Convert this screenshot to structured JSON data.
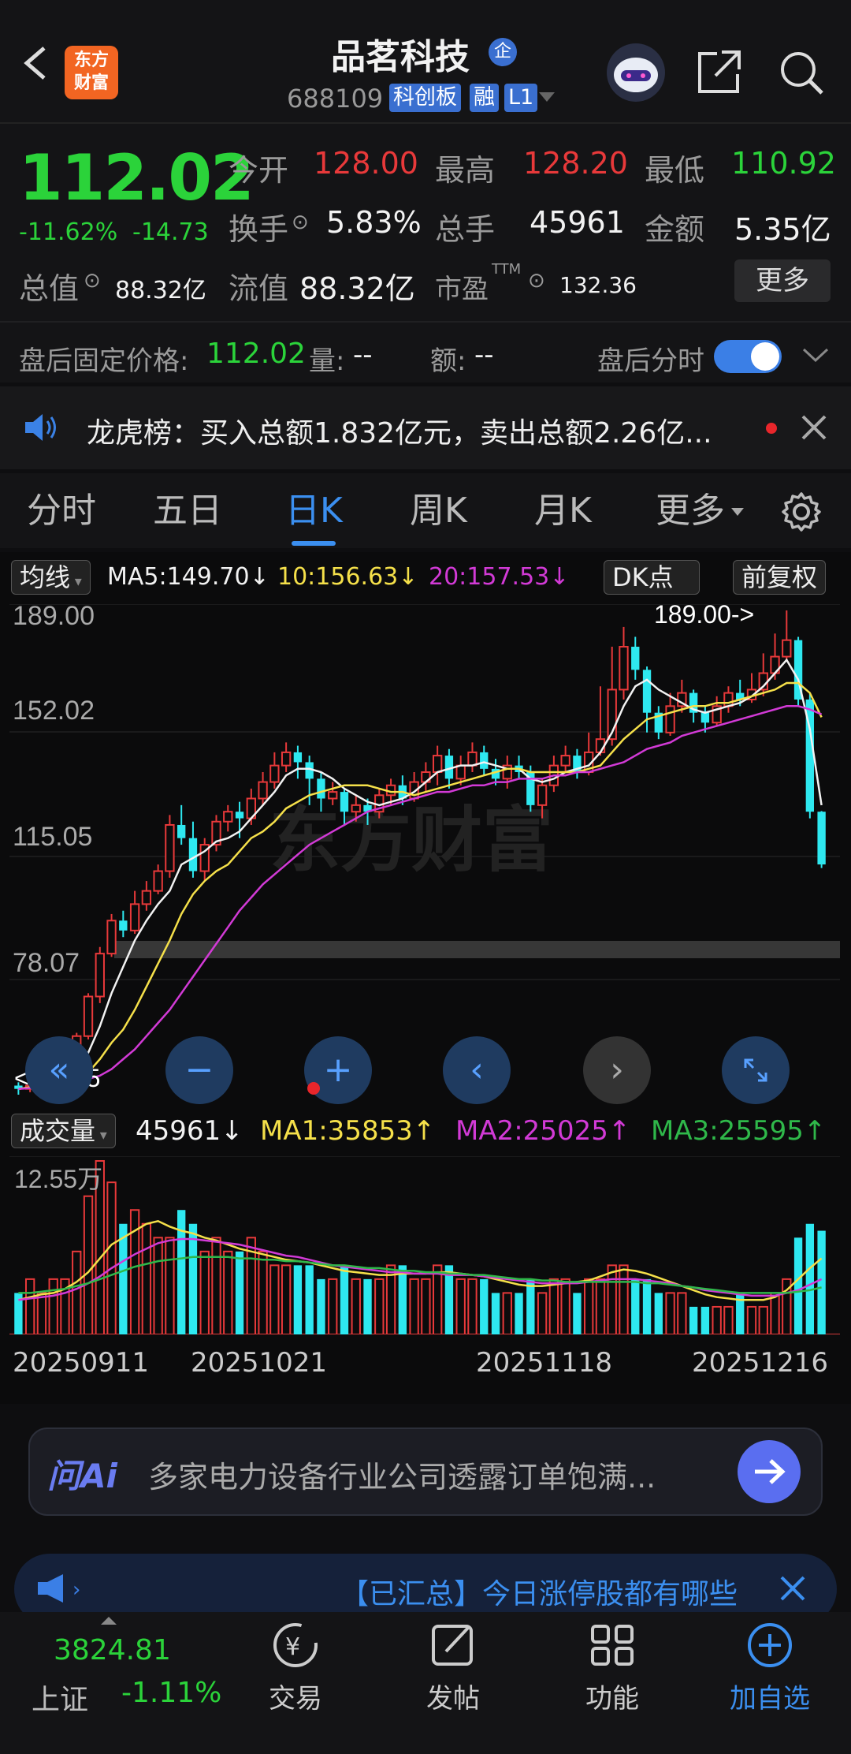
{
  "header": {
    "logo_line1": "东方",
    "logo_line2": "财富",
    "stock_name": "品茗科技",
    "badge_qi": "企",
    "stock_code": "688109",
    "tag_board": "科创板",
    "tag_margin": "融",
    "tag_level": "L1"
  },
  "quote": {
    "price": "112.02",
    "change_pct": "-11.62%",
    "change_amt": "-14.73",
    "open_label": "今开",
    "open": "128.00",
    "high_label": "最高",
    "high": "128.20",
    "low_label": "最低",
    "low": "110.92",
    "turnover_label": "换手",
    "turnover": "5.83%",
    "volume_label": "总手",
    "volume": "45961",
    "amount_label": "金额",
    "amount": "5.35亿",
    "mktcap_label": "总值",
    "mktcap": "88.32亿",
    "float_label": "流值",
    "float_cap": "88.32亿",
    "pe_label": "市盈",
    "pe_sup": "TTM",
    "pe": "132.36",
    "more_label": "更多"
  },
  "after_hours": {
    "label": "盘后固定价格:",
    "price": "112.02",
    "vol_label": "量:",
    "vol": "--",
    "amt_label": "额:",
    "amt": "--",
    "timeshare_label": "盘后分时"
  },
  "notice": {
    "text": "龙虎榜：买入总额1.832亿元，卖出总额2.26亿..."
  },
  "tabs": [
    "分时",
    "五日",
    "日K",
    "周K",
    "月K",
    "更多"
  ],
  "kline": {
    "ma_label": "均线",
    "ma5": "MA5:149.70↓",
    "ma10": "10:156.63↓",
    "ma20": "20:157.53↓",
    "dk_label": "DK点",
    "adjust_label": "前复权",
    "y_labels": [
      "189.00",
      "152.02",
      "115.05",
      "78.07"
    ],
    "high_marker": "189.00->",
    "low_marker": "<-42.25",
    "watermark": "东方财富"
  },
  "volume": {
    "label": "成交量",
    "value": "45961↓",
    "ma1": "MA1:35853↑",
    "ma2": "MA2:25025↑",
    "ma3": "MA3:25595↑",
    "y_label": "12.55万",
    "dates": [
      "20250911",
      "20251021",
      "20251118",
      "20251216"
    ]
  },
  "ai": {
    "logo": "问Ai",
    "text": "多家电力设备行业公司透露订单饱满..."
  },
  "banner": {
    "text": "【已汇总】今日涨停股都有哪些"
  },
  "bottom_nav": {
    "index_value": "3824.81",
    "index_name": "上证",
    "index_change": "-1.11%",
    "items": [
      "交易",
      "发帖",
      "功能",
      "加自选"
    ]
  },
  "chart_data": {
    "type": "candlestick",
    "ylim": [
      42.25,
      189.0
    ],
    "candles": [
      [
        45,
        44,
        46,
        42.25
      ],
      [
        44,
        45,
        46,
        43
      ],
      [
        45,
        46,
        47,
        44
      ],
      [
        46,
        47,
        48,
        45
      ],
      [
        47,
        50,
        51,
        46
      ],
      [
        50,
        60,
        61,
        49
      ],
      [
        60,
        72,
        73,
        59
      ],
      [
        72,
        85,
        87,
        70
      ],
      [
        85,
        95,
        97,
        84
      ],
      [
        95,
        92,
        98,
        90
      ],
      [
        92,
        100,
        104,
        91
      ],
      [
        100,
        104,
        107,
        98
      ],
      [
        104,
        110,
        112,
        103
      ],
      [
        110,
        124,
        127,
        108
      ],
      [
        124,
        120,
        130,
        118
      ],
      [
        120,
        110,
        125,
        108
      ],
      [
        110,
        118,
        120,
        107
      ],
      [
        118,
        125,
        127,
        116
      ],
      [
        125,
        128,
        130,
        122
      ],
      [
        128,
        126,
        131,
        120
      ],
      [
        126,
        132,
        135,
        124
      ],
      [
        132,
        137,
        140,
        130
      ],
      [
        137,
        142,
        146,
        135
      ],
      [
        142,
        146,
        149,
        140
      ],
      [
        146,
        143,
        148,
        138
      ],
      [
        143,
        138,
        145,
        130
      ],
      [
        138,
        132,
        140,
        128
      ],
      [
        132,
        134,
        137,
        130
      ],
      [
        134,
        128,
        135,
        124
      ],
      [
        128,
        130,
        133,
        125
      ],
      [
        130,
        128,
        132,
        124
      ],
      [
        128,
        133,
        135,
        126
      ],
      [
        133,
        136,
        138,
        130
      ],
      [
        136,
        132,
        139,
        130
      ],
      [
        132,
        137,
        140,
        131
      ],
      [
        137,
        140,
        143,
        134
      ],
      [
        140,
        145,
        148,
        136
      ],
      [
        145,
        138,
        147,
        135
      ],
      [
        138,
        142,
        145,
        136
      ],
      [
        142,
        146,
        149,
        140
      ],
      [
        146,
        141,
        148,
        139
      ],
      [
        141,
        138,
        144,
        136
      ],
      [
        138,
        142,
        145,
        135
      ],
      [
        142,
        140,
        145,
        138
      ],
      [
        140,
        130,
        142,
        128
      ],
      [
        130,
        136,
        138,
        126
      ],
      [
        136,
        142,
        145,
        134
      ],
      [
        142,
        145,
        148,
        140
      ],
      [
        145,
        140,
        147,
        138
      ],
      [
        140,
        146,
        152,
        139
      ],
      [
        146,
        150,
        166,
        145
      ],
      [
        150,
        165,
        178,
        148
      ],
      [
        165,
        178,
        184,
        162
      ],
      [
        178,
        171,
        181,
        168
      ],
      [
        171,
        158,
        172,
        152
      ],
      [
        158,
        152,
        160,
        150
      ],
      [
        152,
        160,
        164,
        151
      ],
      [
        160,
        164,
        168,
        158
      ],
      [
        164,
        158,
        165,
        155
      ],
      [
        158,
        155,
        160,
        152
      ],
      [
        155,
        160,
        163,
        154
      ],
      [
        160,
        164,
        166,
        158
      ],
      [
        164,
        162,
        168,
        160
      ],
      [
        162,
        165,
        170,
        161
      ],
      [
        165,
        170,
        176,
        163
      ],
      [
        170,
        175,
        182,
        168
      ],
      [
        175,
        180,
        189,
        174
      ],
      [
        180,
        162,
        181,
        160
      ],
      [
        162,
        128,
        164,
        126
      ],
      [
        128,
        112.02,
        128.2,
        110.92
      ]
    ],
    "ma5": [
      44,
      44.5,
      45,
      46,
      47,
      50,
      55,
      63,
      73,
      81,
      89,
      95,
      100,
      104,
      112,
      114,
      116,
      119,
      120,
      122,
      126,
      130,
      134,
      139,
      141,
      141,
      140,
      138,
      135,
      133,
      131,
      130,
      131,
      132,
      134,
      137,
      140,
      141,
      142,
      142,
      143,
      142,
      141,
      141,
      138,
      137,
      138,
      140,
      141,
      142,
      146,
      152,
      160,
      166,
      168,
      165,
      163,
      161,
      159,
      158,
      159,
      160,
      161,
      163,
      166,
      170,
      174,
      168,
      153,
      130
    ],
    "ma10": [
      44,
      44.5,
      45,
      45.5,
      46,
      47,
      49,
      53,
      58,
      62,
      68,
      75,
      82,
      89,
      97,
      103,
      107,
      110,
      112,
      116,
      120,
      122,
      125,
      129,
      131,
      133,
      134,
      135,
      136,
      136,
      136,
      135,
      134,
      134,
      133,
      134,
      135,
      136,
      137,
      138,
      139,
      140,
      141,
      141,
      140,
      140,
      140,
      140,
      140,
      141,
      142,
      146,
      150,
      153,
      156,
      157,
      158,
      159,
      160,
      160,
      161,
      161,
      162,
      163,
      164,
      165,
      167,
      167,
      164,
      156.63
    ],
    "ma20": [
      44,
      44.2,
      44.5,
      45,
      45.5,
      46,
      47,
      48,
      50,
      53,
      56,
      60,
      64,
      68,
      73,
      78,
      83,
      88,
      93,
      98,
      102,
      106,
      109,
      112,
      115,
      118,
      120,
      122,
      124,
      126,
      128,
      129,
      130,
      131,
      132,
      133,
      134,
      134,
      135,
      136,
      136,
      137,
      137,
      138,
      138,
      138,
      139,
      139,
      140,
      140,
      141,
      142,
      143,
      145,
      147,
      148,
      149,
      151,
      152,
      153,
      154,
      155,
      156,
      157,
      158,
      159,
      160,
      160,
      159,
      157.53
    ],
    "volumes": [
      3,
      4,
      3,
      4,
      4,
      6,
      10,
      12.55,
      11,
      8,
      9,
      8,
      7,
      7,
      9,
      8,
      6,
      7,
      6,
      6,
      7,
      6,
      5,
      5,
      5,
      5,
      4,
      4,
      5,
      4,
      4,
      4,
      5,
      5,
      4,
      4,
      5,
      5,
      4,
      4,
      4,
      3,
      3,
      3,
      4,
      3,
      4,
      4,
      3,
      4,
      4,
      5,
      5,
      4,
      4,
      3,
      3,
      3,
      2,
      2,
      2,
      2,
      3,
      2,
      2,
      3,
      4,
      7,
      8,
      7.5
    ],
    "vol_ma1": [
      2.5,
      2.7,
      2.9,
      3,
      3.3,
      3.8,
      4.5,
      5.5,
      6.5,
      7,
      7.5,
      8,
      8.2,
      7.8,
      7.5,
      7.3,
      7,
      6.8,
      6.5,
      6.2,
      6,
      5.8,
      5.6,
      5.4,
      5.3,
      5.2,
      5,
      4.8,
      4.6,
      4.5,
      4.4,
      4.3,
      4.3,
      4.4,
      4.4,
      4.4,
      4.5,
      4.5,
      4.4,
      4.3,
      4.2,
      4,
      3.8,
      3.6,
      3.5,
      3.5,
      3.6,
      3.7,
      3.8,
      3.9,
      4.2,
      4.5,
      4.7,
      4.6,
      4.4,
      4.1,
      3.8,
      3.5,
      3.2,
      2.9,
      2.7,
      2.6,
      2.5,
      2.5,
      2.5,
      2.7,
      3.2,
      4,
      4.8,
      5.5
    ],
    "vol_ma2": [
      2.5,
      2.6,
      2.7,
      2.8,
      3,
      3.3,
      3.7,
      4.2,
      4.8,
      5.3,
      5.8,
      6.2,
      6.6,
      6.8,
      6.9,
      6.9,
      6.8,
      6.7,
      6.6,
      6.5,
      6.3,
      6.1,
      5.9,
      5.7,
      5.6,
      5.4,
      5.2,
      5,
      4.9,
      4.8,
      4.7,
      4.6,
      4.5,
      4.5,
      4.4,
      4.4,
      4.4,
      4.3,
      4.3,
      4.3,
      4.2,
      4.1,
      4,
      3.9,
      3.8,
      3.7,
      3.7,
      3.7,
      3.7,
      3.8,
      3.9,
      4,
      4,
      4,
      3.9,
      3.8,
      3.7,
      3.5,
      3.4,
      3.2,
      3.1,
      3,
      2.9,
      2.8,
      2.8,
      2.8,
      3,
      3.2,
      3.6,
      4
    ],
    "vol_ma3": [
      3,
      3,
      3.1,
      3.2,
      3.3,
      3.5,
      3.7,
      4,
      4.3,
      4.6,
      4.9,
      5.1,
      5.3,
      5.4,
      5.5,
      5.6,
      5.6,
      5.6,
      5.6,
      5.5,
      5.5,
      5.4,
      5.4,
      5.3,
      5.3,
      5.2,
      5.1,
      5,
      5,
      4.9,
      4.8,
      4.8,
      4.7,
      4.6,
      4.6,
      4.5,
      4.5,
      4.4,
      4.4,
      4.3,
      4.3,
      4.2,
      4.1,
      4,
      4,
      3.9,
      3.9,
      3.8,
      3.8,
      3.8,
      3.8,
      3.8,
      3.8,
      3.8,
      3.7,
      3.7,
      3.6,
      3.5,
      3.4,
      3.3,
      3.2,
      3.1,
      3,
      3,
      3,
      3,
      3,
      3.1,
      3.2,
      3.4
    ]
  }
}
